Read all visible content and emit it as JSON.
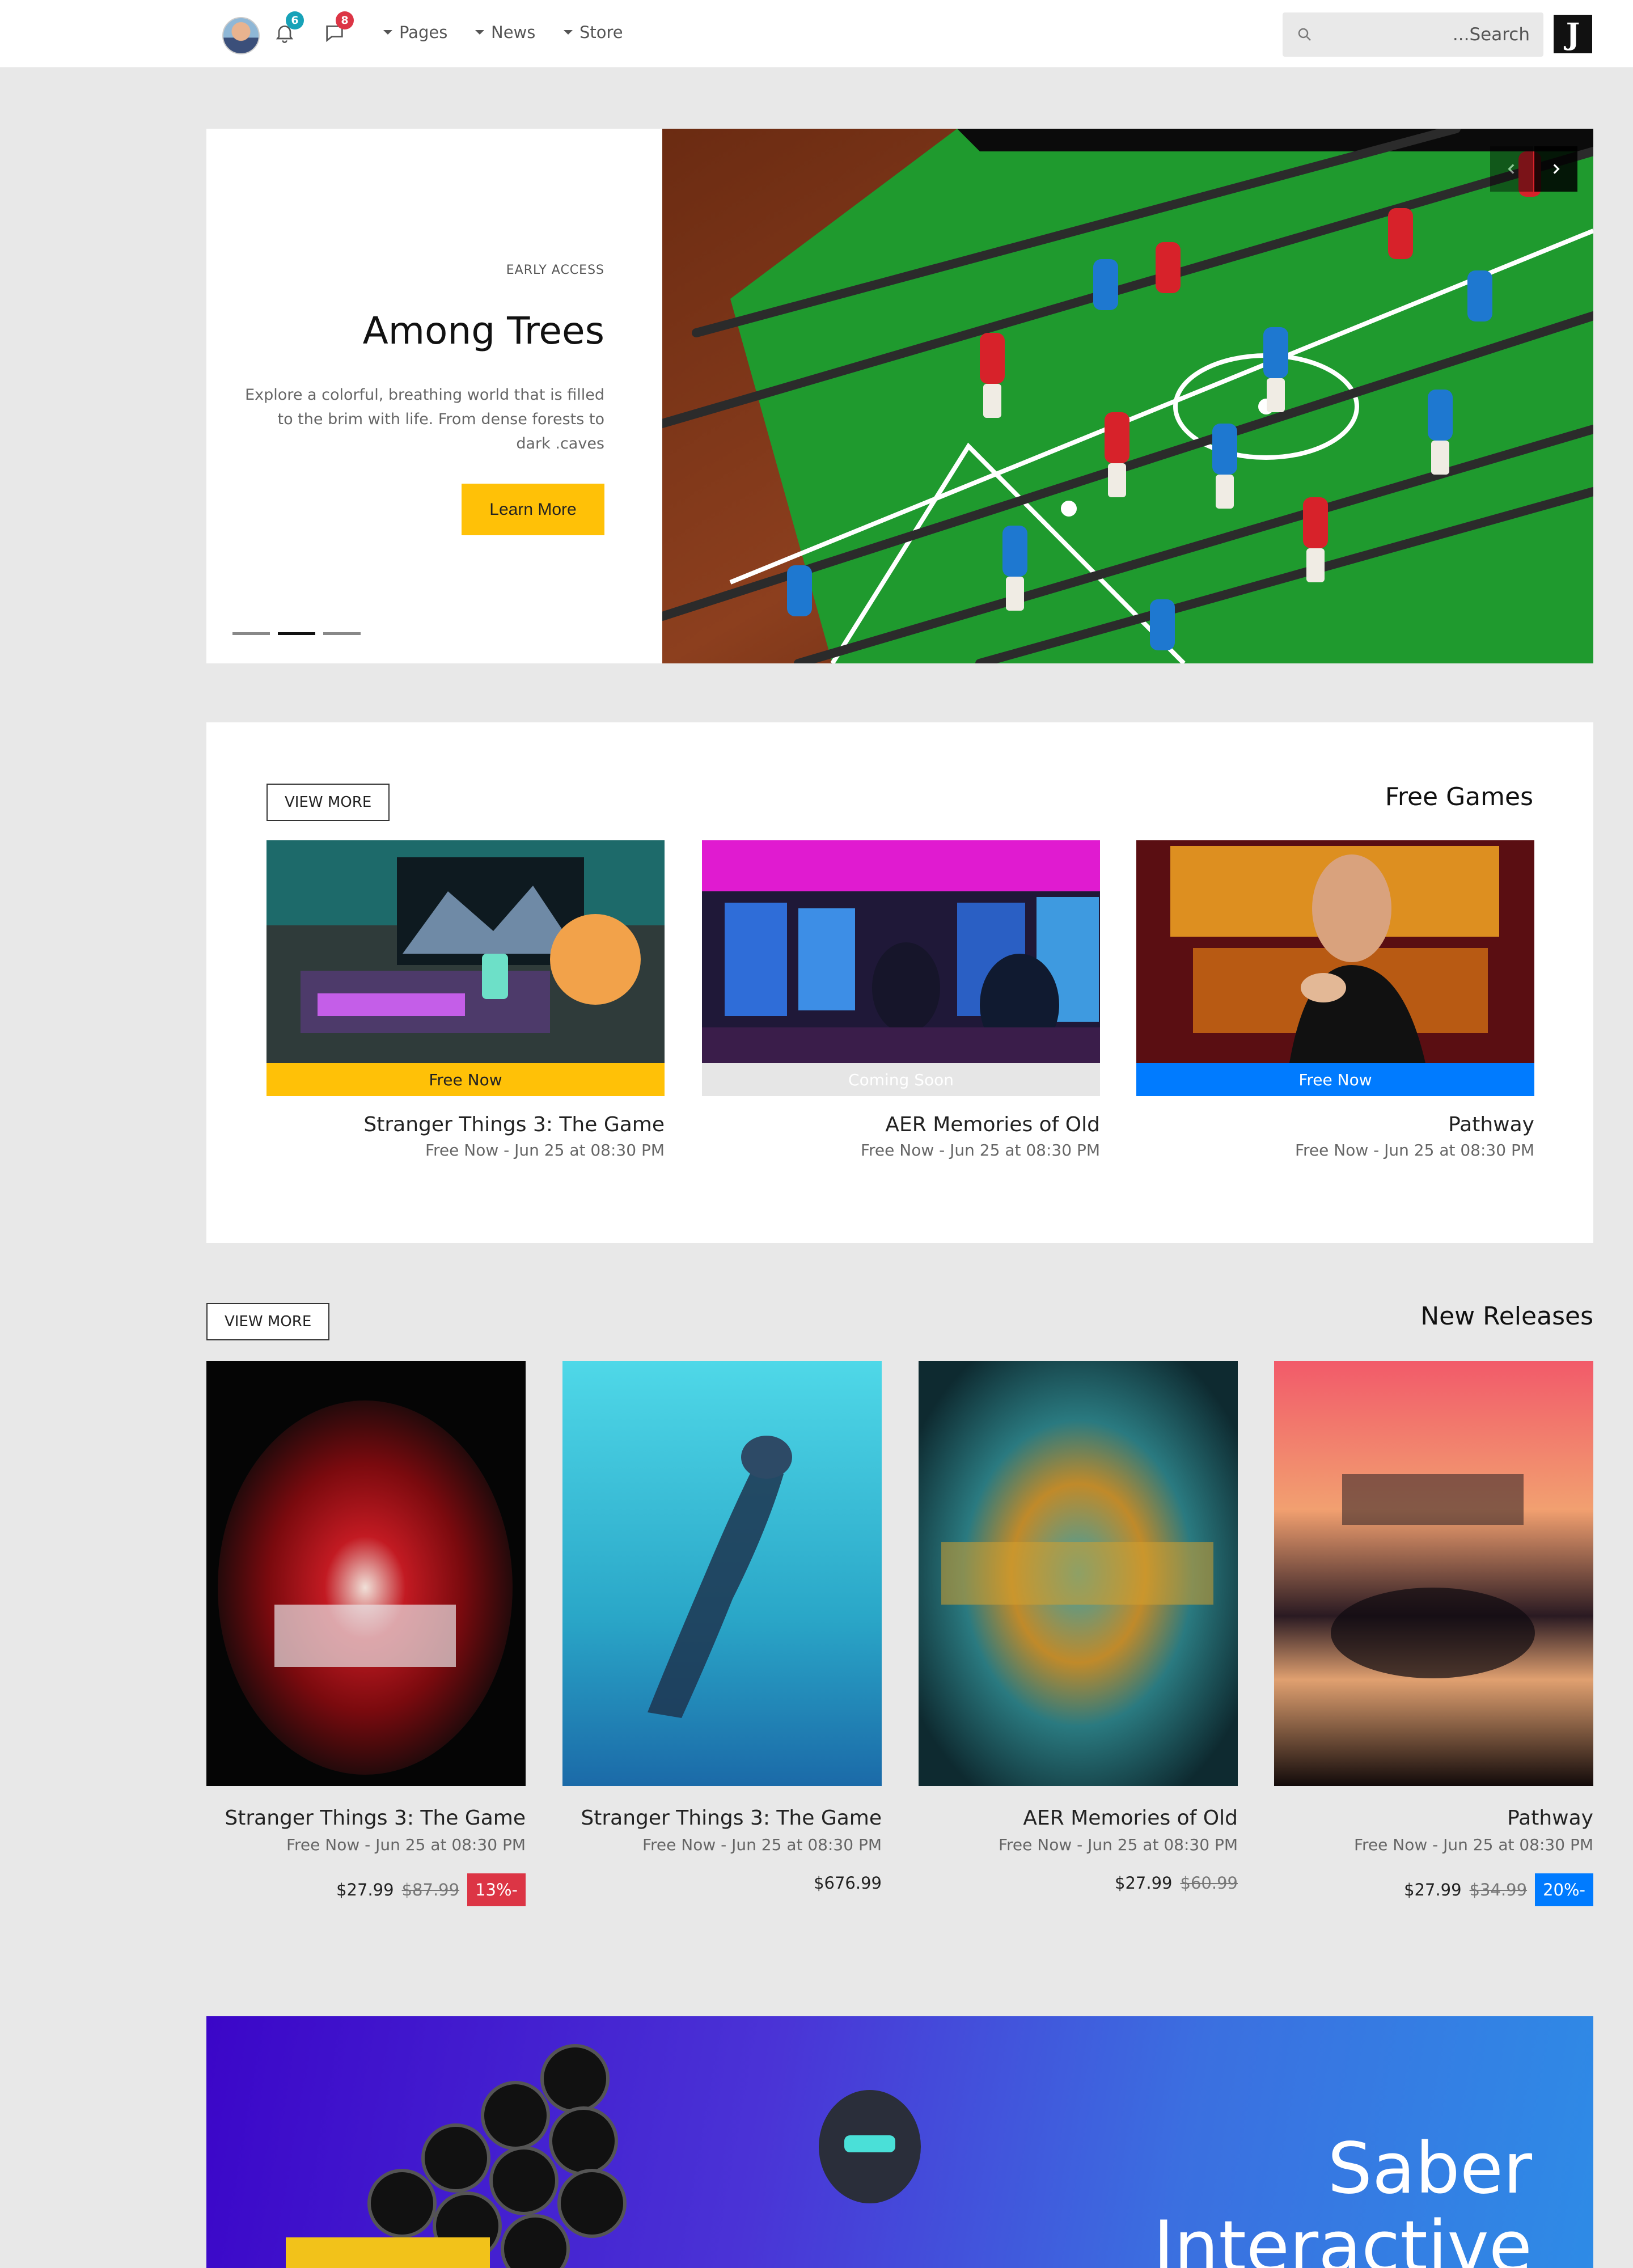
{
  "nav": {
    "notifications_count": "6",
    "messages_count": "8",
    "links": [
      "Pages",
      "News",
      "Store"
    ],
    "search_placeholder": "...Search",
    "logo_letter": "J"
  },
  "hero": {
    "eyebrow": "EARLY ACCESS",
    "title": "Among Trees",
    "description": "Explore a colorful, breathing world that is filled to the brim with life. From dense forests to dark .caves",
    "button": "Learn More",
    "slides_total": 3,
    "active_slide": 2
  },
  "free_games": {
    "title": "Free Games",
    "view_more": "VIEW MORE",
    "cards": [
      {
        "status": "Free Now",
        "status_color": "#ffc107",
        "status_text_color": "#222222",
        "title": "Stranger Things 3: The Game",
        "date": "Free Now - Jun 25 at 08:30 PM"
      },
      {
        "status": "Coming Soon",
        "status_color": "#e6e6e6",
        "status_text_color": "#ffffff",
        "title": "AER Memories of Old",
        "date": "Free Now - Jun 25 at 08:30 PM"
      },
      {
        "status": "Free Now",
        "status_color": "#007bff",
        "status_text_color": "#ffffff",
        "title": "Pathway",
        "date": "Free Now - Jun 25 at 08:30 PM"
      }
    ]
  },
  "new_releases": {
    "title": "New Releases",
    "view_more": "VIEW MORE",
    "cards": [
      {
        "title": "Stranger Things 3: The Game",
        "date": "Free Now - Jun 25 at 08:30 PM",
        "price": "$27.99",
        "old_price": "$87.99",
        "discount": "13%-"
      },
      {
        "title": "Stranger Things 3: The Game",
        "date": "Free Now - Jun 25 at 08:30 PM",
        "price": "$676.99",
        "old_price": "",
        "discount": ""
      },
      {
        "title": "AER Memories of Old",
        "date": "Free Now - Jun 25 at 08:30 PM",
        "price": "$27.99",
        "old_price": "$60.99",
        "discount": ""
      },
      {
        "title": "Pathway",
        "date": "Free Now - Jun 25 at 08:30 PM",
        "price": "$27.99",
        "old_price": "$34.99",
        "discount": "20%-"
      }
    ]
  },
  "promo": {
    "title_line1": "Saber",
    "title_line2": "Interactive"
  }
}
